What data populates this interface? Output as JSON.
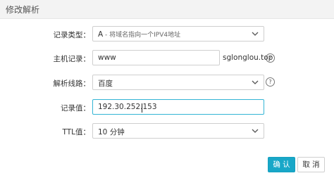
{
  "dialog": {
    "title": "修改解析"
  },
  "form": {
    "record_type": {
      "label": "记录类型：",
      "value": "A",
      "hint": " - 将域名指向一个IPV4地址"
    },
    "host": {
      "label": "主机记录：",
      "value": "www",
      "suffix": "sglonglou.top",
      "help": "?"
    },
    "line": {
      "label": "解析线路：",
      "value": "百度",
      "help": "?"
    },
    "record_value": {
      "label": "记录值：",
      "value": "192.30.252.153"
    },
    "ttl": {
      "label": "TTL值：",
      "value": "10 分钟"
    }
  },
  "buttons": {
    "confirm": "确 认",
    "cancel": "取 消"
  },
  "colors": {
    "accent": "#18a7c8",
    "focus_border": "#33b5d5",
    "header_bg": "#f3f3f3"
  }
}
